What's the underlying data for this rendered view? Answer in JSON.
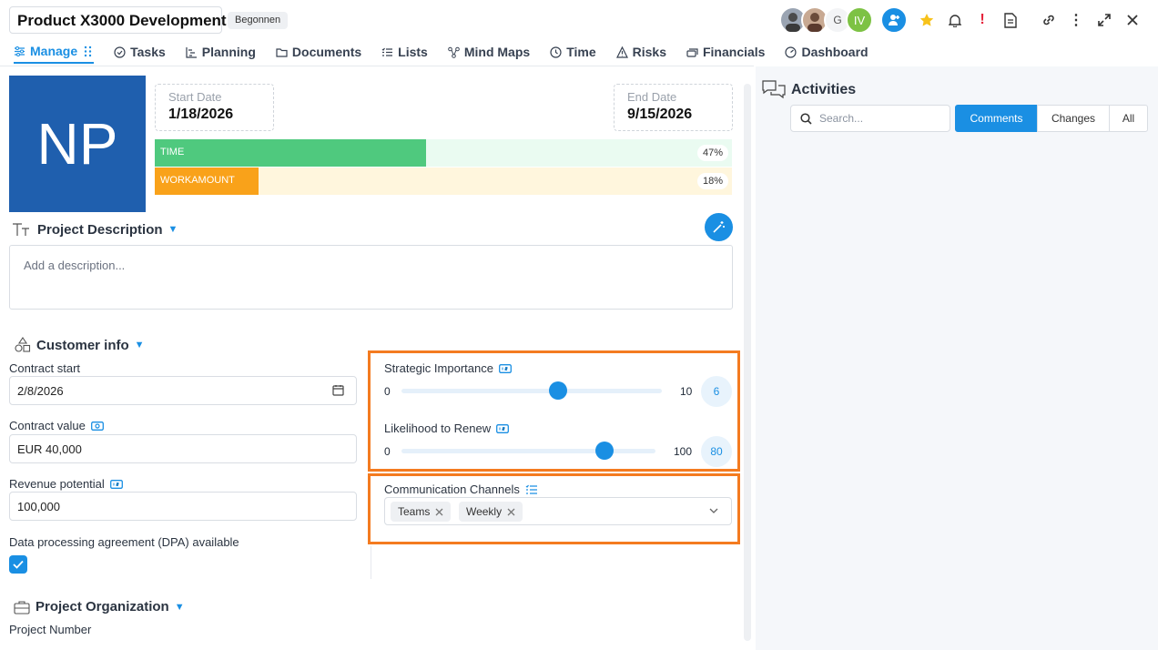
{
  "header": {
    "title": "Product X3000 Development",
    "status": "Begonnen",
    "avatars": [
      "G",
      "IV"
    ]
  },
  "tabs": [
    {
      "label": "Manage",
      "icon": "sliders-icon"
    },
    {
      "label": "Tasks",
      "icon": "check-circle-icon"
    },
    {
      "label": "Planning",
      "icon": "gantt-icon"
    },
    {
      "label": "Documents",
      "icon": "folder-icon"
    },
    {
      "label": "Lists",
      "icon": "list-icon"
    },
    {
      "label": "Mind Maps",
      "icon": "mindmap-icon"
    },
    {
      "label": "Time",
      "icon": "clock-icon"
    },
    {
      "label": "Risks",
      "icon": "warning-icon"
    },
    {
      "label": "Financials",
      "icon": "coins-icon"
    },
    {
      "label": "Dashboard",
      "icon": "gauge-icon"
    }
  ],
  "project": {
    "initials": "NP",
    "start_label": "Start Date",
    "start_value": "1/18/2026",
    "end_label": "End Date",
    "end_value": "9/15/2026",
    "time_label": "TIME",
    "time_pct": "47%",
    "time_fraction": 0.47,
    "work_label": "WORKAMOUNT",
    "work_pct": "18%",
    "work_fraction": 0.18
  },
  "description": {
    "heading": "Project Description",
    "placeholder": "Add a description..."
  },
  "customer": {
    "heading": "Customer info",
    "contract_start_label": "Contract start",
    "contract_start_value": "2/8/2026",
    "contract_value_label": "Contract value",
    "contract_value_value": "EUR 40,000",
    "revenue_label": "Revenue potential",
    "revenue_value": "100,000",
    "dpa_label": "Data processing agreement (DPA) available",
    "dpa_checked": true
  },
  "sliders": [
    {
      "label": "Strategic Importance",
      "min": "0",
      "max": "10",
      "value": "6",
      "fraction": 0.6
    },
    {
      "label": "Likelihood to Renew",
      "min": "0",
      "max": "100",
      "value": "80",
      "fraction": 0.8
    }
  ],
  "channels": {
    "label": "Communication Channels",
    "chips": [
      "Teams",
      "Weekly"
    ]
  },
  "organization": {
    "heading": "Project Organization",
    "project_number_label": "Project Number"
  },
  "activities": {
    "heading": "Activities",
    "search_placeholder": "Search...",
    "filters": [
      "Comments",
      "Changes",
      "All"
    ],
    "active_filter": "Comments"
  },
  "colors": {
    "accent": "#1a8fe3",
    "time_fill": "#4fc97e",
    "time_bg": "#eafbf1",
    "work_fill": "#f9a21a",
    "work_bg": "#fff6dd",
    "highlight": "#f47b20",
    "tile": "#1f5fae"
  }
}
